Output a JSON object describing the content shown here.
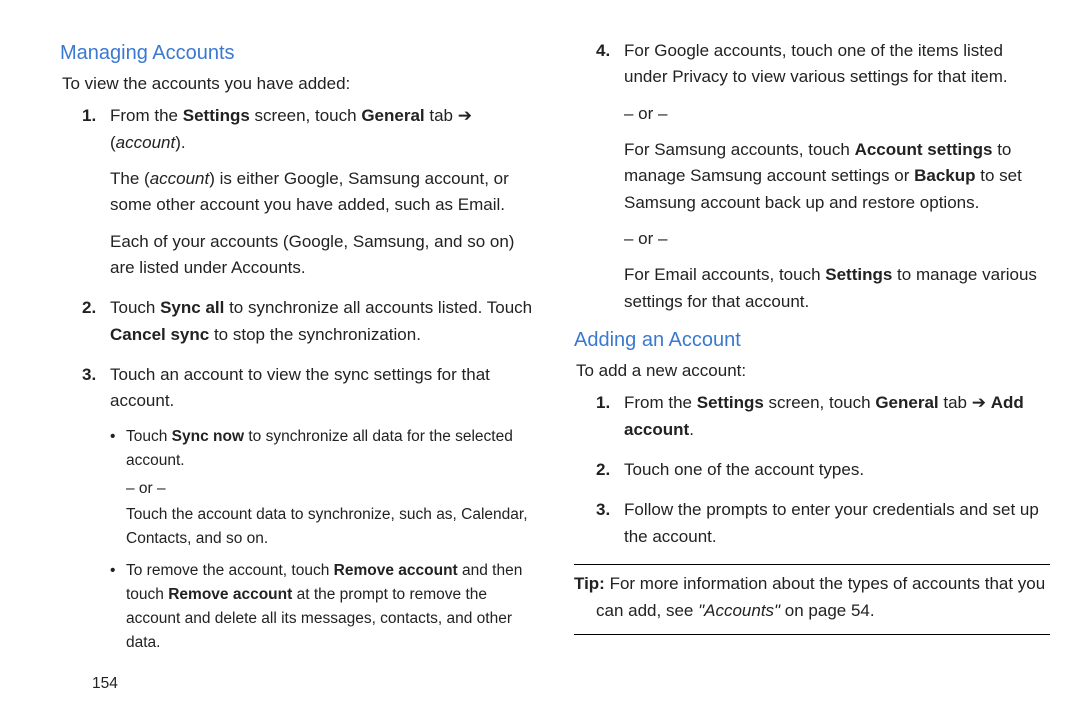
{
  "page_number": "154",
  "words": {
    "settings": "Settings",
    "general": "General",
    "sync_all": "Sync all",
    "cancel_sync": "Cancel sync",
    "sync_now": "Sync now",
    "remove_account": "Remove account",
    "account_settings": "Account settings",
    "backup": "Backup",
    "add_account": "Add account",
    "accounts_ref": "\"Accounts\""
  },
  "sec1": {
    "heading": "Managing Accounts",
    "intro": "To view the accounts you have added:",
    "s1": {
      "pre": "From the ",
      "mid": " screen, touch ",
      "tab": " tab ➔ (",
      "account_it": "account",
      "end": ").",
      "p2_pre": "The (",
      "p2_mid": ") is either Google, Samsung account, or some other account you have added, such as Email.",
      "p3": "Each of your accounts (Google, Samsung, and so on) are listed under Accounts."
    },
    "s2": {
      "a": "Touch ",
      "b": " to synchronize all accounts listed. Touch ",
      "c": " to stop the synchronization."
    },
    "s3": {
      "text": "Touch an account to view the sync settings for that account.",
      "b1a": "Touch ",
      "b1b": " to synchronize all data for the selected account.",
      "or1": "– or –",
      "b1c": "Touch the account data to synchronize, such as, Calendar, Contacts, and so on.",
      "b2a": "To remove the account, touch ",
      "b2b": " and then touch ",
      "b2c": " at the prompt to remove the account and delete all its messages, contacts, and other data."
    },
    "s4": {
      "a": "For Google accounts, touch one of the items listed under Privacy to view various settings for that item.",
      "or": "– or –",
      "b1": "For Samsung accounts, touch ",
      "b2": " to manage Samsung account settings or ",
      "b3": " to set Samsung account back up and restore options.",
      "c1": "For Email accounts, touch ",
      "c2": " to manage various settings for that account."
    }
  },
  "sec2": {
    "heading": "Adding an Account",
    "intro": "To add a new account:",
    "s1": {
      "pre": "From the ",
      "mid": " screen, touch ",
      "tab": " tab ➔ ",
      "end": "."
    },
    "s2": "Touch one of the account types.",
    "s3": "Follow the prompts to enter your credentials and set up the account."
  },
  "tip": {
    "label": "Tip:",
    "a": " For more information about the types of accounts that you can add, see ",
    "b": " on page 54."
  }
}
